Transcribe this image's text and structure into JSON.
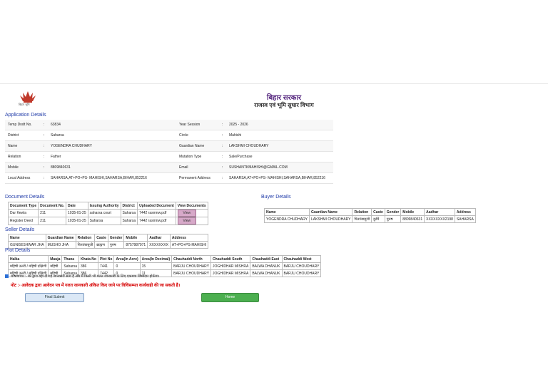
{
  "header": {
    "logo_caption": "बिहार भूमि",
    "title": "बिहार सरकार",
    "subtitle": "राजस्व एवं भूमि सुधार विभाग"
  },
  "application": {
    "heading": "Application Details",
    "rows": [
      {
        "l1": "Temp Draft No.",
        "v1": "63834",
        "l2": "Year Session",
        "v2": "2025 - 2026"
      },
      {
        "l1": "District",
        "v1": "Saharsa",
        "l2": "Circle",
        "v2": "Mahishi"
      },
      {
        "l1": "Name",
        "v1": "YOGENDRA CHUDHARY",
        "l2": "Guardian Name",
        "v2": "LAKSHMI CHOUDHARY"
      },
      {
        "l1": "Relation",
        "v1": "Father",
        "l2": "Mutation Type",
        "v2": "Sale/Purchase"
      },
      {
        "l1": "Mobile",
        "v1": "8809840631",
        "l2": "Email",
        "v2": "SUSHANTKMAHISHI@GMAIL.COM"
      },
      {
        "l1": "Local Address",
        "v1": "SAHARSA,AT+PO+PS- MAHISHI,SAHARSA,BIHAR,852216",
        "l2": "Permanent Address",
        "v2": "SAHARSA,AT+PO+PS- MAHISHI,SAHARSA,BIHAR,852216"
      }
    ]
  },
  "documents": {
    "heading": "Document Details",
    "headers": [
      "Document Type",
      "Document No.",
      "Date",
      "Issuing Authority",
      "District",
      "Uploaded Document",
      "View Documents"
    ],
    "rows": [
      [
        "Dar Kewla",
        "211",
        "1035-01-25",
        "saharsa court",
        "Saharsa",
        "7442 rasmnw.pdf",
        "View"
      ],
      [
        "Register Deed",
        "211",
        "1035-01-25",
        "Saharsa",
        "Saharsa",
        "7442 rasmnw.pdf",
        "View"
      ]
    ]
  },
  "buyer": {
    "heading": "Buyer Details",
    "headers": [
      "Name",
      "Guardian Name",
      "Relation",
      "Caste",
      "Gender",
      "Mobile",
      "Aadhar",
      "Address"
    ],
    "rows": [
      [
        "YOGENDRA CHUDHARY",
        "LAKSHMI CHOUDHARY",
        "पिता/बाबूजी",
        "कुर्मि",
        "पुरुष",
        "8809840631",
        "XXXXXXXX2198",
        "SAHARSA"
      ]
    ]
  },
  "seller": {
    "heading": "Seller Details",
    "headers": [
      "Name",
      "Guardian Name",
      "Relation",
      "Caste",
      "Gender",
      "Mobile",
      "Aadhar",
      "Address"
    ],
    "rows": [
      [
        "GUNGESHWAR JHA",
        "MUSHO JHA",
        "पिता/बाबूजी",
        "ब्राह्मण",
        "पुरुष",
        "8757987971",
        "XXXXXXXX",
        "AT+PO+PS-MAHISHI"
      ]
    ]
  },
  "plot": {
    "heading": "Plot Details",
    "headers": [
      "Halka",
      "Mauja",
      "Thana",
      "Khata No",
      "Plot No",
      "Area(In Acre)",
      "Area(In Decimal)",
      "Chauhaddi North",
      "Chauhaddi South",
      "Chauhaddi East",
      "Chauhaddi West"
    ],
    "rows": [
      [
        "महिषी उत्तरी / महिषी दक्षिणी",
        "महिषी",
        "Saharsa",
        "386",
        "7441",
        "0",
        "15",
        "BARJU CHOUDHARY",
        "JOGHIDHAR MISHRA",
        "BALWA DHANUK",
        "BARJU CHOUDHARY"
      ],
      [
        "महिषी उत्तरी / महिषी दक्षिणी",
        "महिषी",
        "Saharsa",
        "386",
        "7442",
        "0",
        "11",
        "BARJU CHOUDHARY",
        "JOGHIDHAR MISHRA",
        "BALWA DHANUK",
        "BARJU CHOUDHARY"
      ]
    ]
  },
  "declaration": "घोषणापत्र :- मेरे द्वारा यहां दी गई जानकारी सत्य है और मैं किसी भी गलत जानकारी के लिए एकमात्र जिम्मेदार होऊँगा।",
  "note": "नोट :- आवेदक द्वारा आवेदन पत्र में गलत जानकारी अंकित किए जाने पर विधिसम्मत कार्यवाही की जा सकती है।",
  "buttons": {
    "submit": "Final Submit",
    "home": "Home"
  },
  "colors": {
    "heading": "#1f3aa8",
    "title": "#5a2c82",
    "note": "#d60000",
    "home": "#4caf50"
  }
}
